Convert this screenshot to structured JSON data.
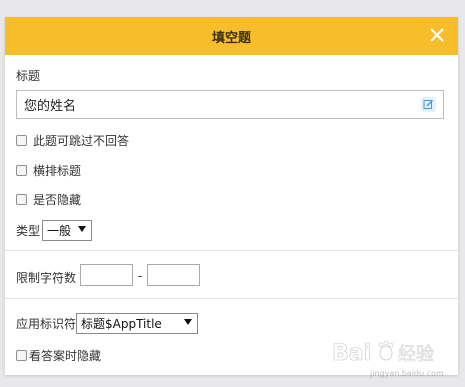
{
  "dialog": {
    "title": "填空题",
    "close_icon": "close-icon"
  },
  "title_section": {
    "label": "标题",
    "value": "您的姓名",
    "edit_icon": "edit-icon"
  },
  "options": {
    "skip_label": "此题可跳过不回答",
    "horizontal_label": "横排标题",
    "hidden_label": "是否隐藏"
  },
  "type": {
    "label": "类型",
    "selected": "一般"
  },
  "limit": {
    "label": "限制字符数",
    "min_value": "",
    "max_value": "",
    "separator": "-"
  },
  "app_id": {
    "label": "应用标识符",
    "selected": "标题$AppTitle"
  },
  "hide_on_view": {
    "label": "看答案时隐藏"
  },
  "watermark": {
    "logo_text": "Bai",
    "logo_suffix": "经验",
    "url": "jingyan.baidu.com"
  },
  "colors": {
    "header_bg": "#f7bd2a",
    "page_bg": "#e8e8ea",
    "edit_icon": "#3b9be0"
  }
}
